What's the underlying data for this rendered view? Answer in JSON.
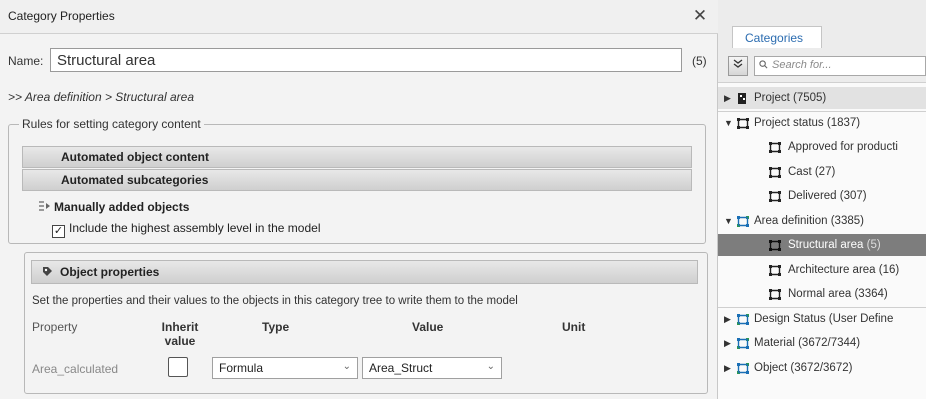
{
  "dialog": {
    "title": "Category Properties",
    "close_glyph": "✕",
    "name_label": "Name:",
    "name_value": "Structural area",
    "name_count": "(5)",
    "breadcrumb": ">> Area definition > Structural area",
    "rules_legend": "Rules for setting category content",
    "automated_object_content": "Automated object content",
    "automated_subcategories": "Automated subcategories",
    "manually_added": "Manually added objects",
    "include_highest": "Include the highest assembly level in the model",
    "include_highest_checked": true,
    "object_properties": "Object properties",
    "props_description": "Set the properties and their values to the objects in this category tree to write them to the model",
    "columns": {
      "property": "Property",
      "inherit": "Inherit value",
      "type": "Type",
      "value": "Value",
      "unit": "Unit"
    },
    "row": {
      "property": "Area_calculated",
      "inherit_checked": false,
      "type": "Formula",
      "value": "Area_Struct"
    }
  },
  "panel": {
    "tab": "Categories",
    "search_placeholder": "Search for...",
    "tree": [
      {
        "label": "Project (7505)",
        "expanded": false,
        "level": 0,
        "icon": "building-icon"
      },
      {
        "label": "Project status (1837)",
        "expanded": true,
        "level": 0,
        "icon": "category-icon"
      },
      {
        "label": "Approved for producti",
        "level": 1,
        "icon": "category-icon"
      },
      {
        "label": "Cast (27)",
        "level": 1,
        "icon": "category-icon"
      },
      {
        "label": "Delivered (307)",
        "level": 1,
        "icon": "category-icon"
      },
      {
        "label": "Area definition (3385)",
        "expanded": true,
        "level": 0,
        "icon": "category-color-icon"
      },
      {
        "label": "Structural area",
        "count": "(5)",
        "level": 1,
        "icon": "category-icon",
        "selected": true
      },
      {
        "label": "Architecture area (16)",
        "level": 1,
        "icon": "category-icon"
      },
      {
        "label": "Normal area (3364)",
        "level": 1,
        "icon": "category-icon"
      },
      {
        "label": "Design Status (User Define",
        "expanded": false,
        "level": 0,
        "icon": "category-color-icon"
      },
      {
        "label": "Material (3672/7344)",
        "expanded": false,
        "level": 0,
        "icon": "category-color-icon"
      },
      {
        "label": "Object (3672/3672)",
        "expanded": false,
        "level": 0,
        "icon": "category-color-icon"
      }
    ]
  },
  "colors": {
    "accent": "#2b6cb0",
    "selected_row": "#7d7d7d"
  }
}
